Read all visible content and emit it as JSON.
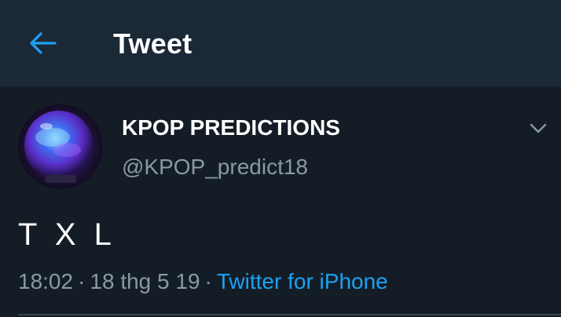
{
  "header": {
    "back_icon": "arrow-left-icon",
    "title": "Tweet"
  },
  "tweet": {
    "author": {
      "display_name": "KPOP PREDICTIONS",
      "username": "@KPOP_predict18",
      "avatar_icon": "crystal-ball-avatar"
    },
    "menu_icon": "chevron-down-icon",
    "text": "T X L",
    "time": "18:02",
    "date": "18 thg 5 19",
    "separator": "·",
    "source": "Twitter for iPhone"
  },
  "colors": {
    "background": "#141d26",
    "header_background": "#1b2836",
    "accent": "#1da1f2",
    "secondary_text": "#8899a6",
    "primary_text": "#ffffff"
  }
}
